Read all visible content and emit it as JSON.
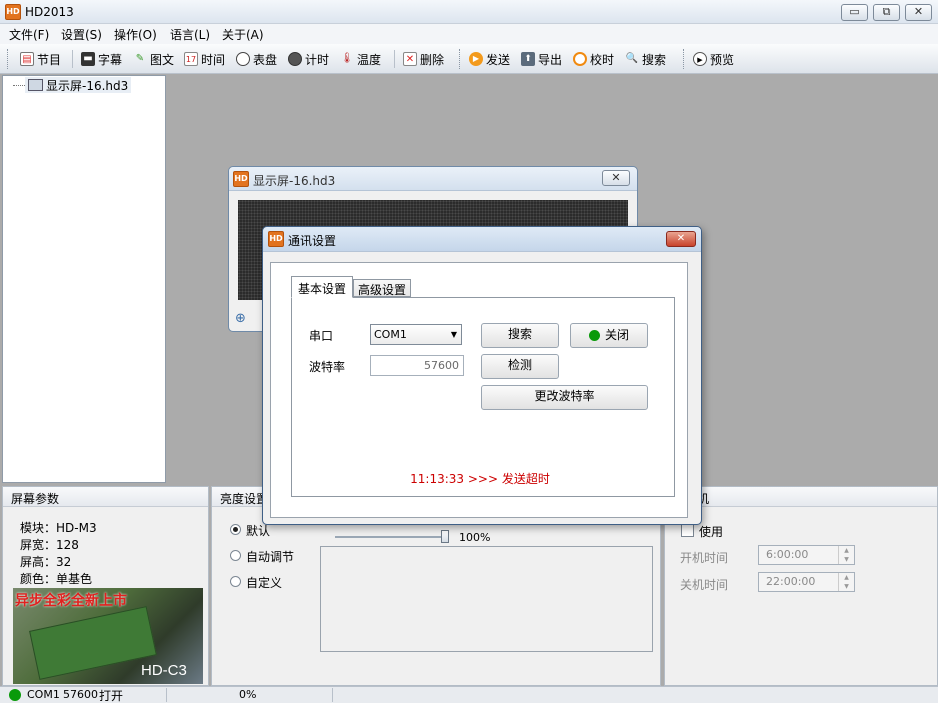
{
  "app": {
    "title": "HD2013",
    "icon_text": "HD"
  },
  "window_controls": {
    "minimize": "▭",
    "restore": "⧉",
    "close": "✕"
  },
  "menu": [
    "文件(F)",
    "设置(S)",
    "操作(O)",
    "语言(L)",
    "关于(A)"
  ],
  "toolbar": {
    "program": "节目",
    "subtitle": "字幕",
    "graphic": "图文",
    "time": "时间",
    "dial": "表盘",
    "timer": "计时",
    "temperature": "温度",
    "delete": "删除",
    "send": "发送",
    "export": "导出",
    "calibrate": "校时",
    "search": "搜索",
    "preview": "预览"
  },
  "tree": {
    "item": "显示屏-16.hd3"
  },
  "screen_window": {
    "title": "显示屏-16.hd3",
    "close": "✕"
  },
  "dialog": {
    "title": "通讯设置",
    "close": "✕",
    "tabs": [
      "基本设置",
      "高级设置"
    ],
    "port_label": "串口",
    "port_value": "COM1",
    "baud_label": "波特率",
    "baud_value": "57600",
    "search_btn": "搜索",
    "close_btn": "关闭",
    "detect_btn": "检测",
    "change_baud_btn": "更改波特率",
    "status_message": "11:13:33 >>> 发送超时",
    "status_color": "#cc0000",
    "close_indicator_color": "#0a9a0a"
  },
  "screen_params": {
    "header": "屏幕参数",
    "lines": [
      "模块：HD-M3",
      "屏宽：128",
      "屏高：32",
      "颜色：单基色"
    ],
    "banner_text": "异步全彩全新上市",
    "card_label": "HD-C3"
  },
  "brightness": {
    "header": "亮度设置",
    "options": [
      "默认",
      "自动调节",
      "自定义"
    ],
    "selected": 0,
    "slider_value": "100%",
    "slider_fraction": 1.0
  },
  "power": {
    "header": "开关机",
    "use_label": "使用",
    "on_label": "开机时间",
    "on_value": "6:00:00",
    "off_label": "关机时间",
    "off_value": "22:00:00"
  },
  "statusbar": {
    "port": "COM1",
    "baud": "57600",
    "state": "打开",
    "progress": "0%",
    "indicator_color": "#0a9a0a"
  }
}
